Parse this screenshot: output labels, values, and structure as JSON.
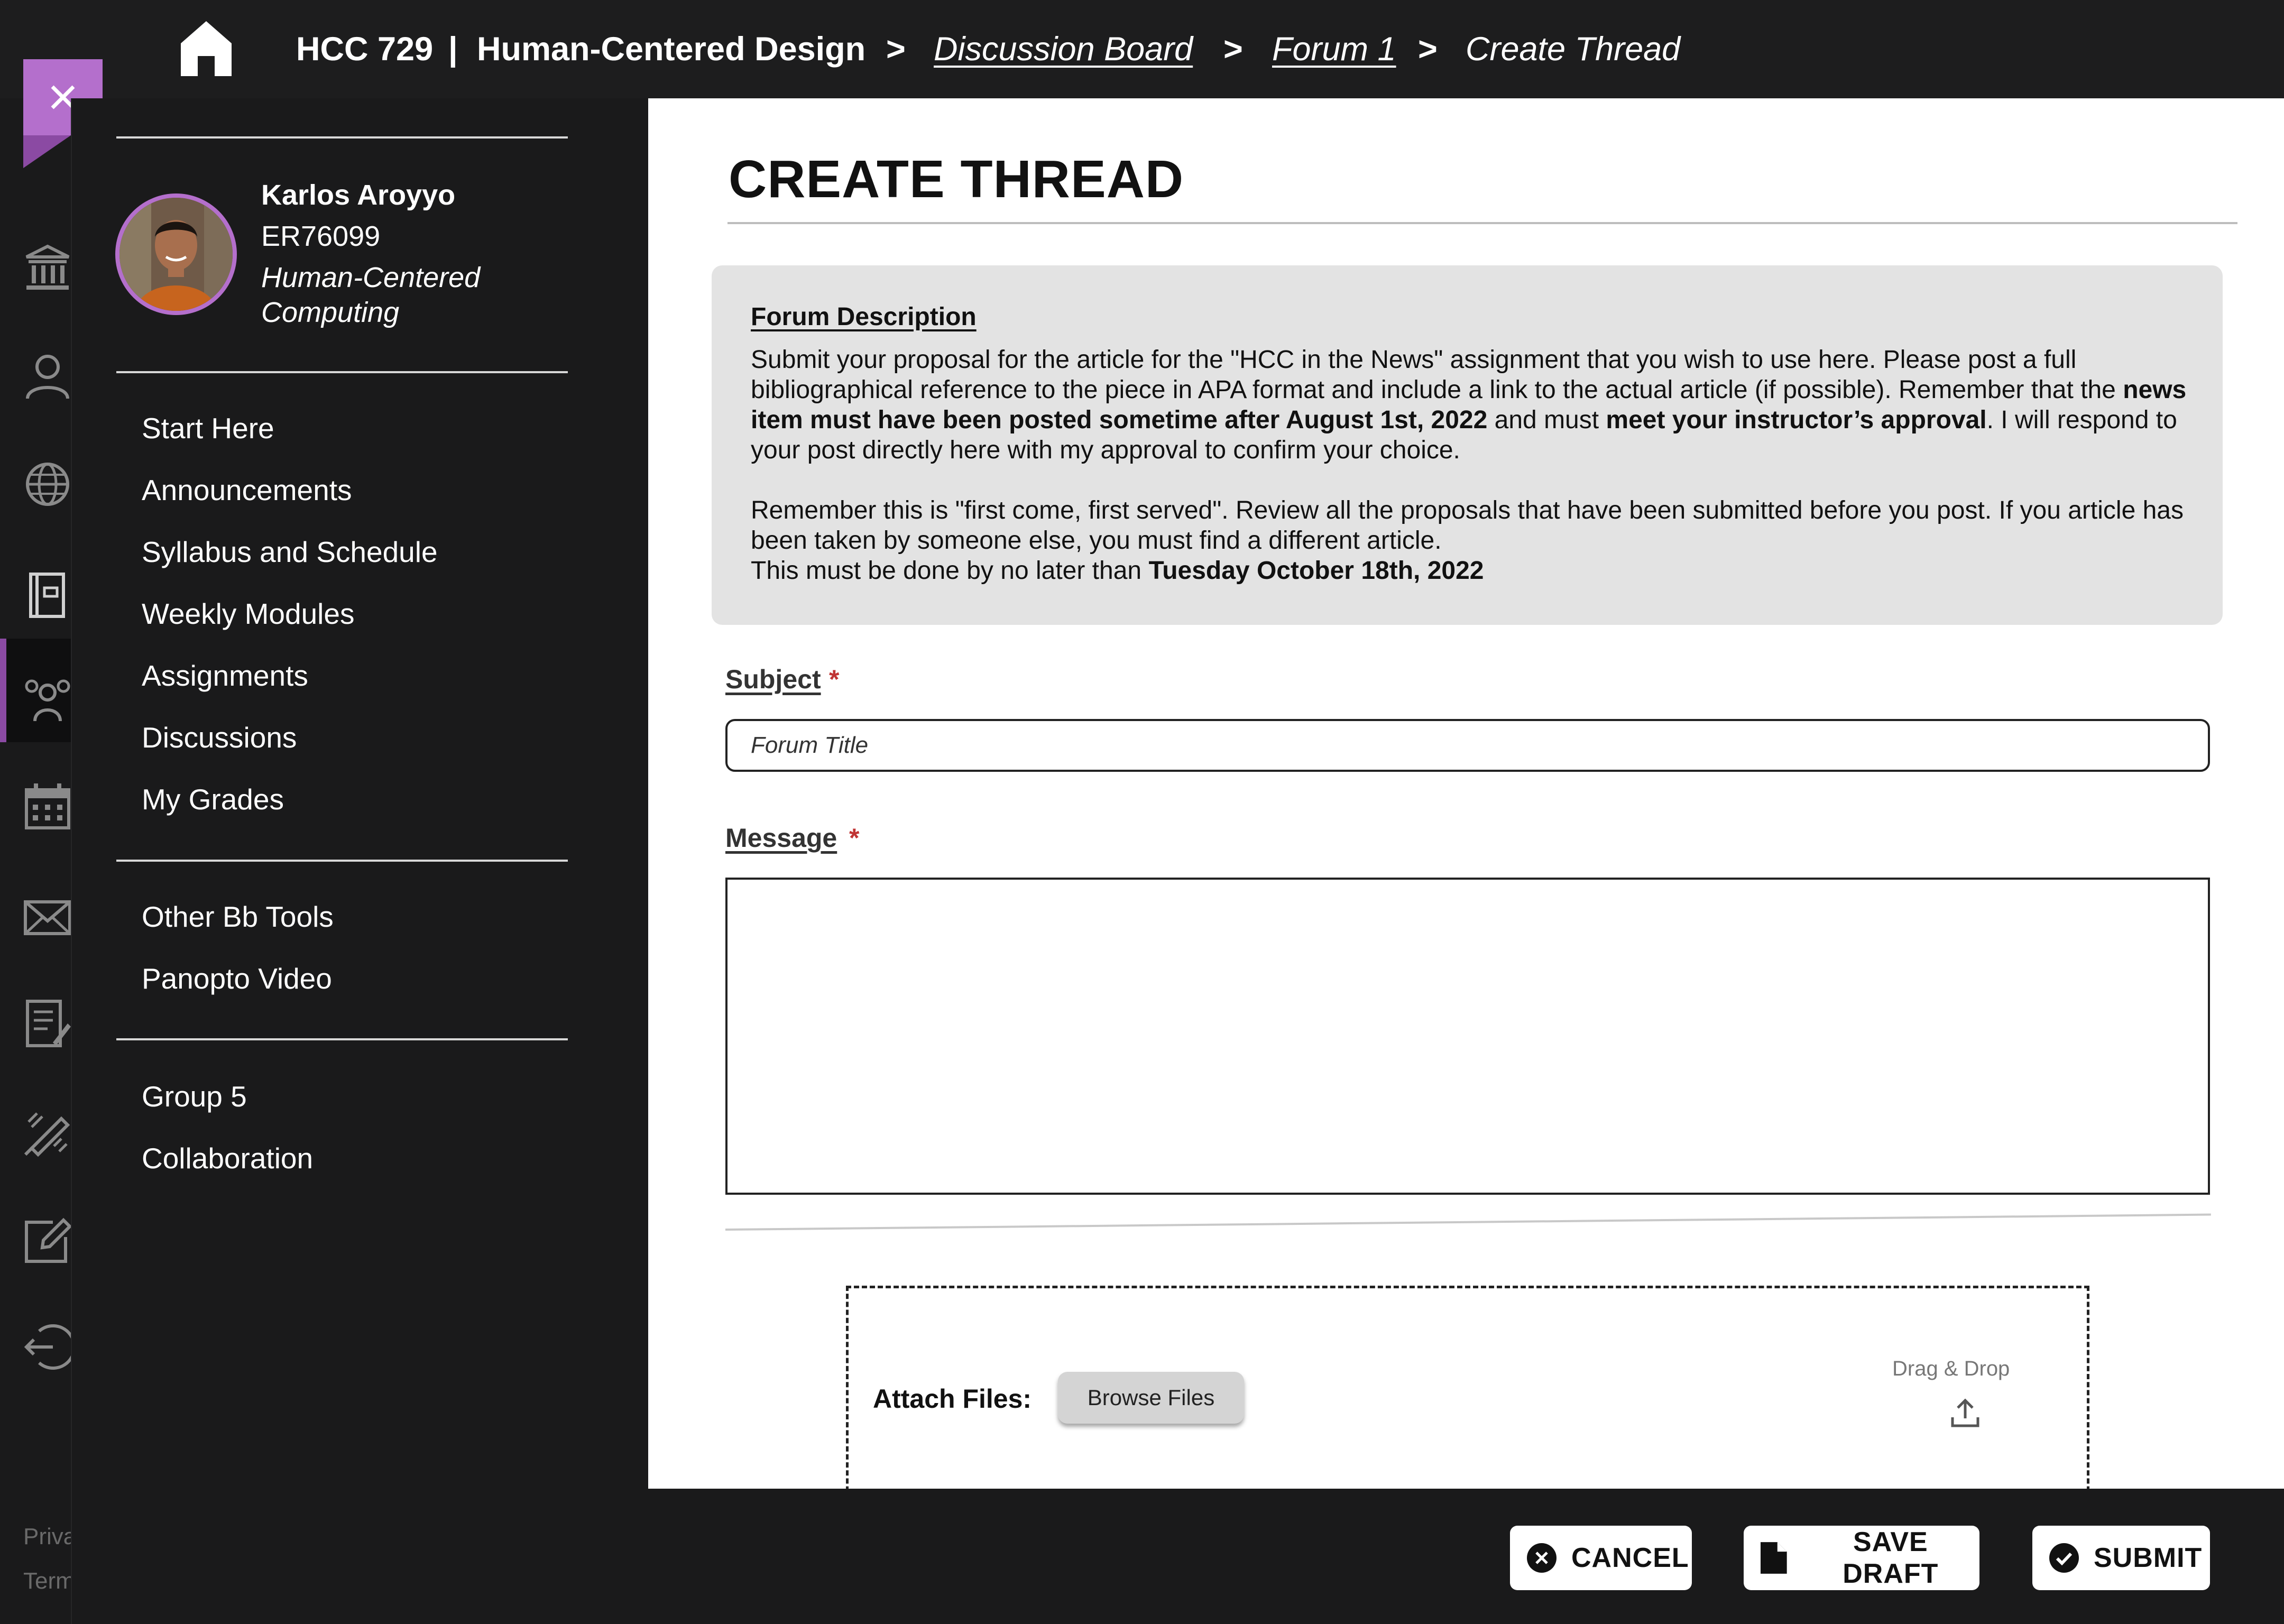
{
  "breadcrumb": {
    "course_code": "HCC 729",
    "pipe": "|",
    "course_name": "Human-Centered Design",
    "separator": ">",
    "items": [
      "Discussion Board",
      "Forum 1",
      "Create Thread"
    ]
  },
  "user": {
    "name": "Karlos Aroyyo",
    "id": "ER76099",
    "department": "Human-Centered Computing"
  },
  "nav": {
    "primary": [
      "Start Here",
      "Announcements",
      "Syllabus and Schedule",
      "Weekly Modules",
      "Assignments",
      "Discussions",
      "My Grades"
    ],
    "tools": [
      "Other Bb Tools",
      "Panopto Video"
    ],
    "groups": [
      "Group 5",
      "Collaboration"
    ]
  },
  "rail_footer": {
    "privacy": "Priva",
    "terms": "Term"
  },
  "page": {
    "title": "CREATE THREAD"
  },
  "forum_description": {
    "heading": "Forum Description",
    "p1_part1": "Submit your proposal for the article for the \"HCC in the News\" assignment that you wish to use here. Please post a full bibliographical reference to the piece in APA format and include a link to the actual article (if possible). Remember that the ",
    "p1_bold1": "news item must have been posted sometime after August 1st, 2022",
    "p1_part2": " and must ",
    "p1_bold2": "meet your instructor’s approval",
    "p1_part3": ". I will respond to your post directly here with my approval to confirm your choice.",
    "p2": "Remember this is \"first come, first served\". Review all the proposals that have been submitted before you post. If you article has been taken by someone else, you must find a different article.",
    "p3_part1": "This must be done by no later than ",
    "p3_bold": "Tuesday October 18th, 2022"
  },
  "form": {
    "subject_label": "Subject",
    "subject_placeholder": "Forum Title",
    "subject_value": "",
    "message_label": "Message",
    "message_value": "",
    "required_mark": "*"
  },
  "attach": {
    "label": "Attach Files:",
    "browse_button": "Browse Files",
    "drag_label": "Drag & Drop"
  },
  "footer_buttons": {
    "cancel": "CANCEL",
    "save_draft": "SAVE DRAFT",
    "submit": "SUBMIT"
  },
  "colors": {
    "accent": "#b46fcc",
    "background_dark": "#1a1a1b",
    "required": "#c03434",
    "description_bg": "#e3e3e3"
  }
}
